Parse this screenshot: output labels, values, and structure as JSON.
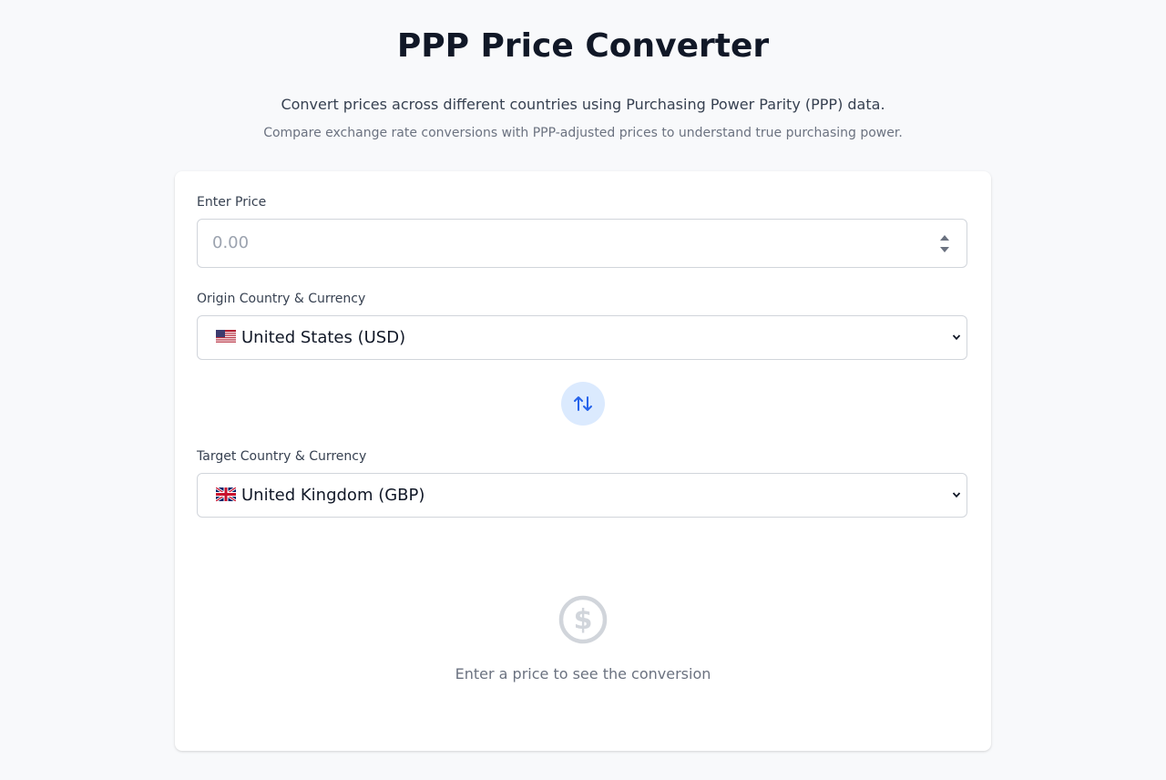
{
  "header": {
    "title": "PPP Price Converter",
    "subtitle": "Convert prices across different countries using Purchasing Power Parity (PPP) data.",
    "description": "Compare exchange rate conversions with PPP-adjusted prices to understand true purchasing power."
  },
  "form": {
    "price_label": "Enter Price",
    "price_placeholder": "0.00",
    "origin_label": "Origin Country & Currency",
    "origin_value": "United States (USD)",
    "origin_flag_icon": "us-flag-icon",
    "swap_icon": "swap-arrows-icon",
    "target_label": "Target Country & Currency",
    "target_value": "United Kingdom (GBP)",
    "target_flag_icon": "uk-flag-icon"
  },
  "result": {
    "empty_icon": "dollar-circle-icon",
    "empty_message": "Enter a price to see the conversion"
  },
  "colors": {
    "page_background": "#f8f9fb",
    "accent": "#2563eb",
    "swap_button_background": "#dbeafe",
    "muted_icon": "#d1d5db"
  }
}
